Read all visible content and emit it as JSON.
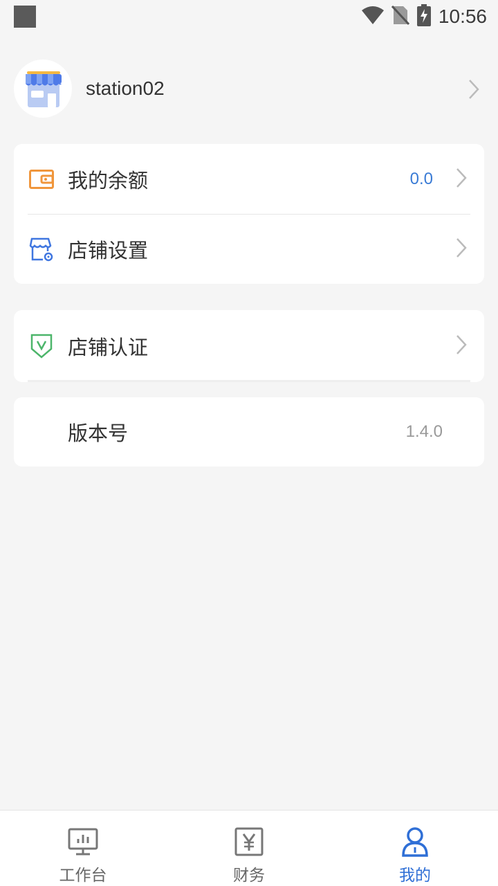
{
  "status_bar": {
    "time": "10:56"
  },
  "profile": {
    "username": "station02"
  },
  "menu_group_1": [
    {
      "label": "我的余额",
      "value": "0.0",
      "icon": "wallet-icon"
    },
    {
      "label": "店铺设置",
      "icon": "store-settings-icon"
    }
  ],
  "menu_group_2": [
    {
      "label": "店铺认证",
      "icon": "shield-check-icon"
    }
  ],
  "version": {
    "label": "版本号",
    "value": "1.4.0"
  },
  "tabbar": {
    "tabs": [
      {
        "label": "工作台",
        "icon": "monitor-chart-icon"
      },
      {
        "label": "财务",
        "icon": "yen-icon"
      },
      {
        "label": "我的",
        "icon": "user-icon"
      }
    ],
    "active_index": 2
  },
  "colors": {
    "accent": "#2f6fd6",
    "wallet": "#f0963c",
    "shield": "#4cb56a"
  }
}
